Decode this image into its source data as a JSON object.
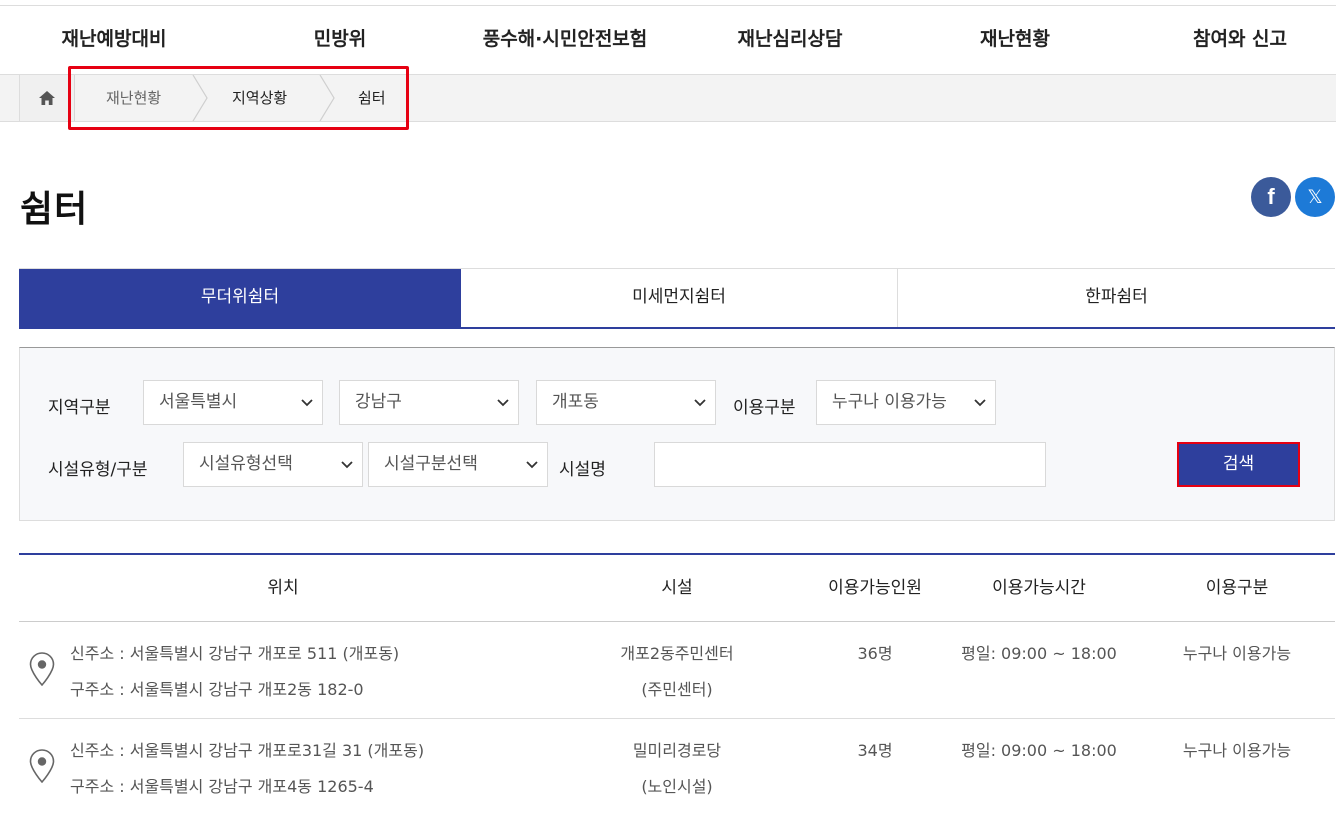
{
  "nav": [
    "재난예방대비",
    "민방위",
    "풍수해·시민안전보험",
    "재난심리상담",
    "재난현황",
    "참여와 신고"
  ],
  "breadcrumb": [
    "재난현황",
    "지역상황",
    "쉼터"
  ],
  "icons": {
    "home": "home-icon",
    "facebook": "facebook-icon",
    "x": "x-icon",
    "pin": "location-pin-icon",
    "dropdown": "chevron-down-icon"
  },
  "page_title": "쉼터",
  "sns": {
    "facebook_glyph": "f",
    "x_glyph": "𝕏"
  },
  "tabs": [
    "무더위쉼터",
    "미세먼지쉼터",
    "한파쉼터"
  ],
  "search": {
    "region_label": "지역구분",
    "city": "서울특별시",
    "district": "강남구",
    "dong": "개포동",
    "usage_label": "이용구분",
    "usage": "누구나 이용가능",
    "facility_type_label": "시설유형/구분",
    "facility_type": "시설유형선택",
    "facility_category": "시설구분선택",
    "facility_name_label": "시설명",
    "facility_name_value": "",
    "button": "검색"
  },
  "table": {
    "headers": [
      "위치",
      "시설",
      "이용가능인원",
      "이용가능시간",
      "이용구분"
    ],
    "rows": [
      {
        "new_addr": "신주소 : 서울특별시 강남구 개포로 511 (개포동)",
        "old_addr": "구주소 : 서울특별시 강남구 개포2동 182-0",
        "facility": "개포2동주민센터",
        "facility_type": "(주민센터)",
        "capacity": "36명",
        "hours": "평일: 09:00 ~ 18:00",
        "usage": "누구나 이용가능"
      },
      {
        "new_addr": "신주소 : 서울특별시 강남구 개포로31길 31 (개포동)",
        "old_addr": "구주소 : 서울특별시 강남구 개포4동 1265-4",
        "facility": "밀미리경로당",
        "facility_type": "(노인시설)",
        "capacity": "34명",
        "hours": "평일: 09:00 ~ 18:00",
        "usage": "누구나 이용가능"
      }
    ]
  },
  "colors": {
    "primary": "#2e3f9d",
    "highlight": "#e60012",
    "facebook": "#3b5a9a",
    "x": "#1d7ad7"
  }
}
